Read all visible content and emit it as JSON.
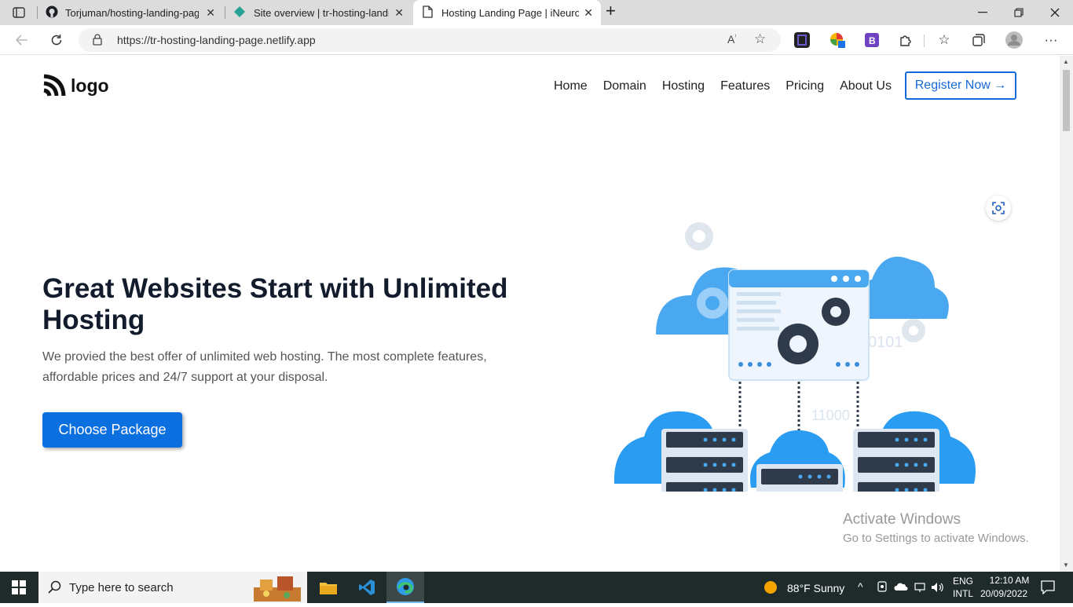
{
  "browser": {
    "tabs": [
      {
        "title": "Torjuman/hosting-landing-page",
        "close": "✕"
      },
      {
        "title": "Site overview | tr-hosting-landing",
        "close": "✕"
      },
      {
        "title": "Hosting Landing Page | iNeuron",
        "close": "✕"
      }
    ],
    "new_tab": "+",
    "url": "https://tr-hosting-landing-page.netlify.app"
  },
  "site": {
    "logo": "logo",
    "nav": [
      "Home",
      "Domain",
      "Hosting",
      "Features",
      "Pricing",
      "About Us"
    ],
    "register": "Register Now →",
    "headline": "Great Websites Start with Unlimited Hosting",
    "description": "We provied the best offer of unlimited web hosting. The most complete features, affordable prices and 24/7 support at your disposal.",
    "cta": "Choose Package",
    "illustration_text": [
      "0101",
      "11000"
    ]
  },
  "watermark": {
    "line1": "Activate Windows",
    "line2": "Go to Settings to activate Windows."
  },
  "taskbar": {
    "search_placeholder": "Type here to search",
    "weather": "88°F  Sunny",
    "lang1": "ENG",
    "lang2": "INTL",
    "time": "12:10 AM",
    "date": "20/09/2022"
  },
  "colors": {
    "accent": "#0c6fe0",
    "outline": "#1669d8",
    "cloud": "#4aa8f0",
    "server": "#2f3a4a"
  }
}
